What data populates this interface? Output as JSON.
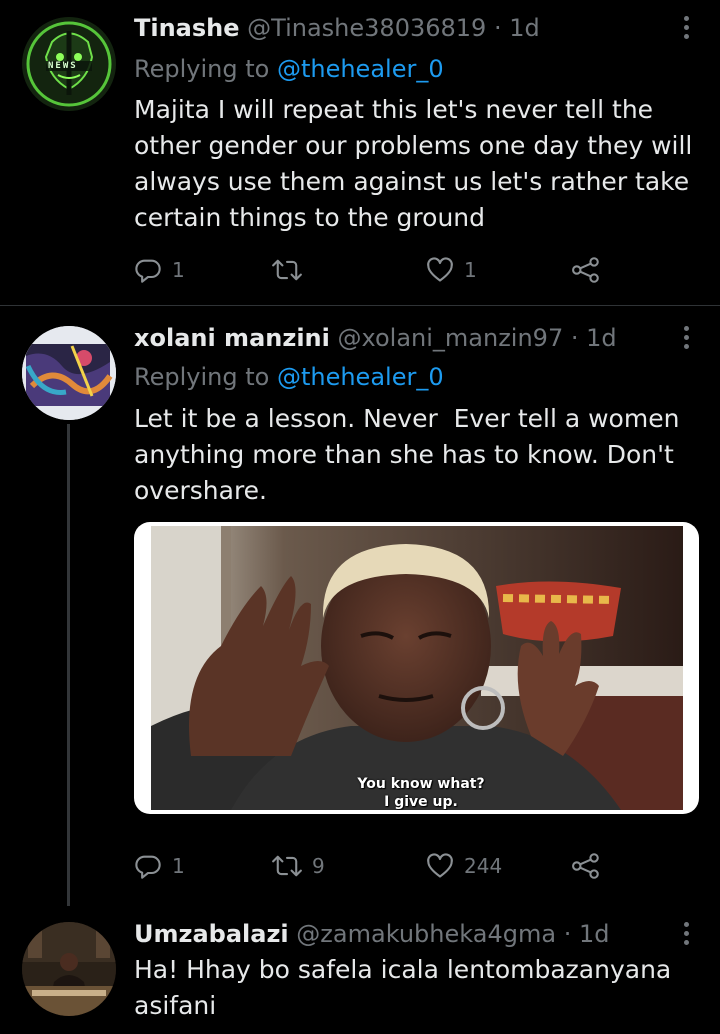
{
  "tweets": [
    {
      "name": "Tinashe",
      "handle": "@Tinashe38036819",
      "time": "· 1d",
      "reply_prefix": "Replying to",
      "reply_handle": "@thehealer_0",
      "lines": [
        "Majita I will repeat this let's never tell the",
        "other gender our problems one day they will",
        "always use them against us let's rather take",
        "certain things to the ground"
      ],
      "replies": "1",
      "retweets": "",
      "likes": "1",
      "avatar_text": "NEWS"
    },
    {
      "name": "xolani manzini",
      "handle": "@xolani_manzin97",
      "time": "· 1d",
      "reply_prefix": "Replying to",
      "reply_handle": "@thehealer_0",
      "lines": [
        "Let it be a lesson. Never  Ever tell a women",
        "anything more than she has to know. Don't",
        "overshare."
      ],
      "replies": "1",
      "retweets": "9",
      "likes": "244",
      "media_caption_1": "You know what?",
      "media_caption_2": "I give up."
    },
    {
      "name": "Umzabalazi",
      "handle": "@zamakubheka4gma",
      "time": "· 1d",
      "lines": [
        "Ha! Hhay bo safela icala lentombazanyana",
        "asifani"
      ]
    }
  ],
  "icons": [
    "reply-icon",
    "retweet-icon",
    "like-icon",
    "share-icon",
    "more-icon"
  ],
  "colors": {
    "background": "#000000",
    "muted": "#71767b",
    "link": "#1d9bf0",
    "text": "#e7e9ea"
  }
}
